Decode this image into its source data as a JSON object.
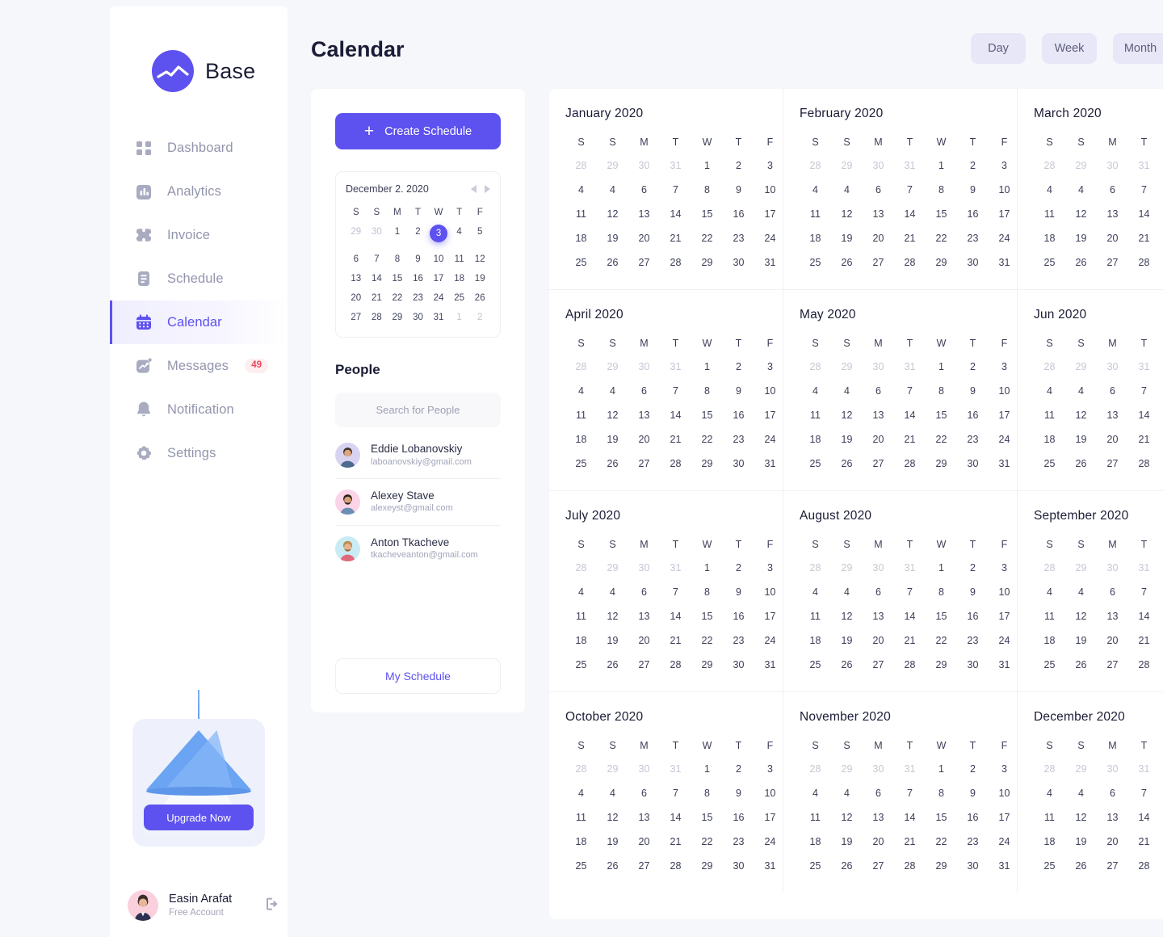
{
  "app": {
    "name": "Base",
    "logo_icon": "chart-circle-logo"
  },
  "sidebar": {
    "items": [
      {
        "label": "Dashboard",
        "icon": "grid-icon",
        "active": false
      },
      {
        "label": "Analytics",
        "icon": "bar-chart-icon",
        "active": false
      },
      {
        "label": "Invoice",
        "icon": "ticket-icon",
        "active": false
      },
      {
        "label": "Schedule",
        "icon": "document-icon",
        "active": false
      },
      {
        "label": "Calendar",
        "icon": "calendar-icon",
        "active": true
      },
      {
        "label": "Messages",
        "icon": "message-chart-icon",
        "active": false,
        "badge": "49"
      },
      {
        "label": "Notification",
        "icon": "bell-icon",
        "active": false
      },
      {
        "label": "Settings",
        "icon": "gear-icon",
        "active": false
      }
    ],
    "upgrade": {
      "button_label": "Upgrade Now",
      "illustration": "pendant-lamp"
    },
    "profile": {
      "name": "Easin Arafat",
      "role": "Free Account",
      "avatar": "user-photo",
      "logout_icon": "logout-icon"
    }
  },
  "header": {
    "title": "Calendar",
    "tabs": [
      {
        "label": "Day"
      },
      {
        "label": "Week"
      },
      {
        "label": "Month"
      }
    ]
  },
  "left_panel": {
    "create_button": {
      "label": "Create Schedule",
      "icon": "plus-icon"
    },
    "mini_calendar": {
      "title": "December 2. 2020",
      "prev_icon": "caret-left-icon",
      "next_icon": "caret-right-icon",
      "dow": [
        "S",
        "S",
        "M",
        "T",
        "W",
        "T",
        "F"
      ],
      "selected_day": "3",
      "weeks": [
        [
          {
            "d": "29",
            "muted": true
          },
          {
            "d": "30",
            "muted": true
          },
          {
            "d": "1"
          },
          {
            "d": "2"
          },
          {
            "d": "3",
            "sel": true
          },
          {
            "d": "4"
          },
          {
            "d": "5"
          }
        ],
        [
          {
            "d": "6"
          },
          {
            "d": "7"
          },
          {
            "d": "8"
          },
          {
            "d": "9"
          },
          {
            "d": "10"
          },
          {
            "d": "11"
          },
          {
            "d": "12"
          }
        ],
        [
          {
            "d": "13"
          },
          {
            "d": "14"
          },
          {
            "d": "15"
          },
          {
            "d": "16"
          },
          {
            "d": "17"
          },
          {
            "d": "18"
          },
          {
            "d": "19"
          }
        ],
        [
          {
            "d": "20"
          },
          {
            "d": "21"
          },
          {
            "d": "22"
          },
          {
            "d": "23"
          },
          {
            "d": "24"
          },
          {
            "d": "25"
          },
          {
            "d": "26"
          }
        ],
        [
          {
            "d": "27"
          },
          {
            "d": "28"
          },
          {
            "d": "29"
          },
          {
            "d": "30"
          },
          {
            "d": "31"
          },
          {
            "d": "1",
            "muted": true
          },
          {
            "d": "2",
            "muted": true
          }
        ]
      ]
    },
    "people": {
      "title": "People",
      "search_placeholder": "Search for People",
      "list": [
        {
          "name": "Eddie Lobanovskiy",
          "email": "laboanovskiy@gmail.com",
          "avatar_tint": "#d9d3f2"
        },
        {
          "name": "Alexey Stave",
          "email": "alexeyst@gmail.com",
          "avatar_tint": "#fbd4e8"
        },
        {
          "name": "Anton Tkacheve",
          "email": "tkacheveanton@gmail.com",
          "avatar_tint": "#c9ecf4"
        }
      ]
    },
    "my_schedule_button": {
      "label": "My Schedule"
    }
  },
  "year_grid": {
    "dow": [
      "S",
      "S",
      "M",
      "T",
      "W",
      "T",
      "F"
    ],
    "weeks": [
      [
        {
          "d": "28",
          "muted": true
        },
        {
          "d": "29",
          "muted": true
        },
        {
          "d": "30",
          "muted": true
        },
        {
          "d": "31",
          "muted": true
        },
        {
          "d": "1"
        },
        {
          "d": "2"
        },
        {
          "d": "3"
        }
      ],
      [
        {
          "d": "4"
        },
        {
          "d": "4"
        },
        {
          "d": "6"
        },
        {
          "d": "7"
        },
        {
          "d": "8"
        },
        {
          "d": "9"
        },
        {
          "d": "10"
        }
      ],
      [
        {
          "d": "11"
        },
        {
          "d": "12"
        },
        {
          "d": "13"
        },
        {
          "d": "14"
        },
        {
          "d": "15"
        },
        {
          "d": "16"
        },
        {
          "d": "17"
        }
      ],
      [
        {
          "d": "18"
        },
        {
          "d": "19"
        },
        {
          "d": "20"
        },
        {
          "d": "21"
        },
        {
          "d": "22"
        },
        {
          "d": "23"
        },
        {
          "d": "24"
        }
      ],
      [
        {
          "d": "25"
        },
        {
          "d": "26"
        },
        {
          "d": "27"
        },
        {
          "d": "28"
        },
        {
          "d": "29"
        },
        {
          "d": "30"
        },
        {
          "d": "31"
        }
      ]
    ],
    "months": [
      "January 2020",
      "February 2020",
      "March 2020",
      "April 2020",
      "May 2020",
      "Jun 2020",
      "July 2020",
      "August 2020",
      "September 2020",
      "October 2020",
      "November 2020",
      "December 2020"
    ]
  },
  "colors": {
    "accent": "#5d51ef",
    "page_bg": "#f6f7fb",
    "panel_bg": "#ffffff",
    "text_dark": "#1b1d36",
    "text_muted": "#9295ad",
    "badge_text": "#e8495f",
    "badge_bg": "#fdeef0",
    "tab_bg": "#e8e7f8",
    "lamp_blue": "#6aa4f2"
  }
}
